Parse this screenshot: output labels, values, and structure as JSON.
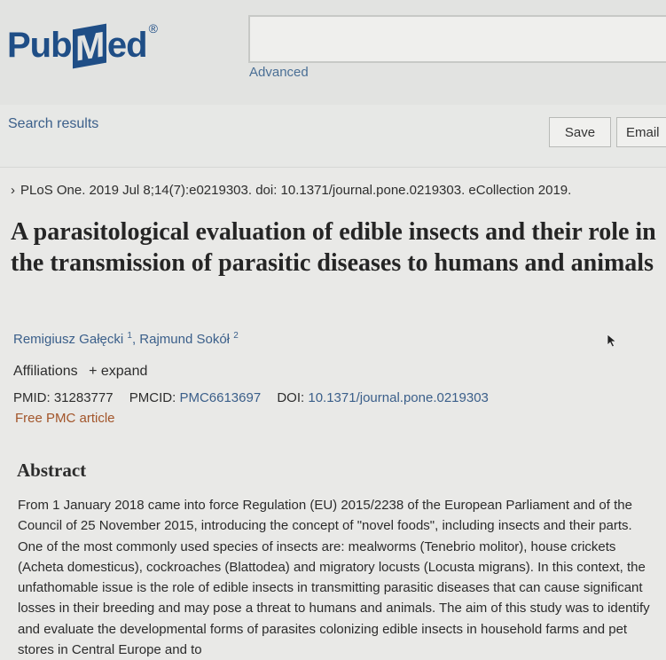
{
  "header": {
    "logo_text": "PubMed",
    "search_placeholder": "",
    "advanced_label": "Advanced"
  },
  "toolbar": {
    "search_results_label": "Search results",
    "save_label": "Save",
    "email_label": "Email"
  },
  "article": {
    "citation": "PLoS One. 2019 Jul 8;14(7):e0219303. doi: 10.1371/journal.pone.0219303. eCollection 2019.",
    "title": "A parasitological evaluation of edible insects and their role in the transmission of parasitic diseases to humans and animals",
    "authors": [
      {
        "name": "Remigiusz Gałęcki",
        "sup": "1"
      },
      {
        "name": "Rajmund Sokół",
        "sup": "2"
      }
    ],
    "affiliations_label": "Affiliations",
    "expand_label": "+ expand",
    "pmid_label": "PMID:",
    "pmid": "31283777",
    "pmcid_label": "PMCID:",
    "pmcid": "PMC6613697",
    "doi_label": "DOI:",
    "doi": "10.1371/journal.pone.0219303",
    "free_pmc_label": "Free PMC article",
    "abstract_heading": "Abstract",
    "abstract_text": "From 1 January 2018 came into force Regulation (EU) 2015/2238 of the European Parliament and of the Council of 25 November 2015, introducing the concept of \"novel foods\", including insects and their parts. One of the most commonly used species of insects are: mealworms (Tenebrio molitor), house crickets (Acheta domesticus), cockroaches (Blattodea) and migratory locusts (Locusta migrans). In this context, the unfathomable issue is the role of edible insects in transmitting parasitic diseases that can cause significant losses in their breeding and may pose a threat to humans and animals. The aim of this study was to identify and evaluate the developmental forms of parasites colonizing edible insects in household farms and pet stores in Central Europe and to"
  },
  "colors": {
    "brand": "#1f4e86",
    "link": "#3b5f8a",
    "free_pmc": "#a2552a"
  }
}
